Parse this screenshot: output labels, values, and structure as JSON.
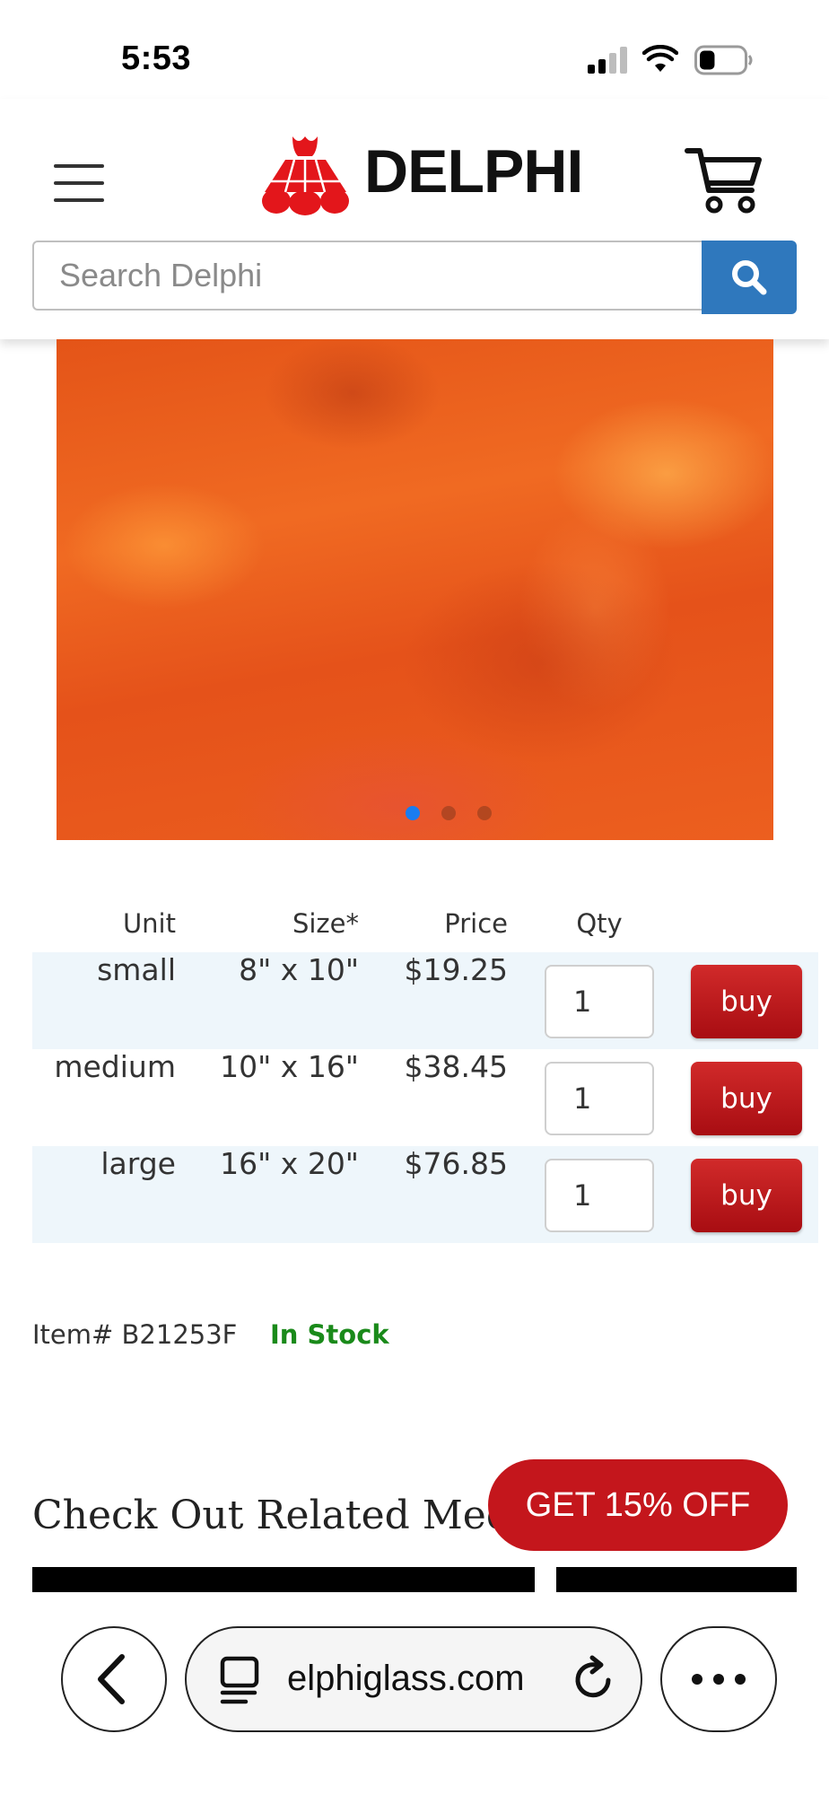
{
  "status_bar": {
    "time": "5:53",
    "signal_icon": "cellular-signal-icon",
    "wifi_icon": "wifi-icon",
    "battery_icon": "battery-icon",
    "battery_level": 0.35
  },
  "header": {
    "menu_icon": "hamburger-menu-icon",
    "logo_text": "DELPHI",
    "logo_color": "#e3161b",
    "cart_icon": "shopping-cart-icon",
    "search": {
      "placeholder": "Search Delphi",
      "button_icon": "search-icon",
      "button_color": "#2f78bd"
    }
  },
  "product": {
    "image_alt": "orange glass sheet",
    "carousel": {
      "count": 3,
      "active_index": 0,
      "active_color": "#1a7cf0"
    }
  },
  "pricing_table": {
    "headers": {
      "unit": "Unit",
      "size": "Size*",
      "price": "Price",
      "qty": "Qty"
    },
    "rows": [
      {
        "unit": "small",
        "size": "8\" x 10\"",
        "price": "$19.25",
        "qty": "1",
        "buy_label": "buy"
      },
      {
        "unit": "medium",
        "size": "10\" x 16\"",
        "price": "$38.45",
        "qty": "1",
        "buy_label": "buy"
      },
      {
        "unit": "large",
        "size": "16\" x 20\"",
        "price": "$76.85",
        "qty": "1",
        "buy_label": "buy"
      }
    ],
    "buy_color": "#c01a1f"
  },
  "item_info": {
    "item_number": "Item# B21253F",
    "stock_status": "In Stock",
    "stock_color": "#1a8a1a"
  },
  "related": {
    "title": "Check Out Related Media"
  },
  "promo": {
    "label": "GET 15% OFF",
    "color": "#c4161c"
  },
  "browser_bar": {
    "back_icon": "chevron-left-icon",
    "tabs_icon": "reader-icon",
    "url": "elphiglass.com",
    "reload_icon": "reload-icon",
    "more_icon": "more-dots-icon"
  }
}
